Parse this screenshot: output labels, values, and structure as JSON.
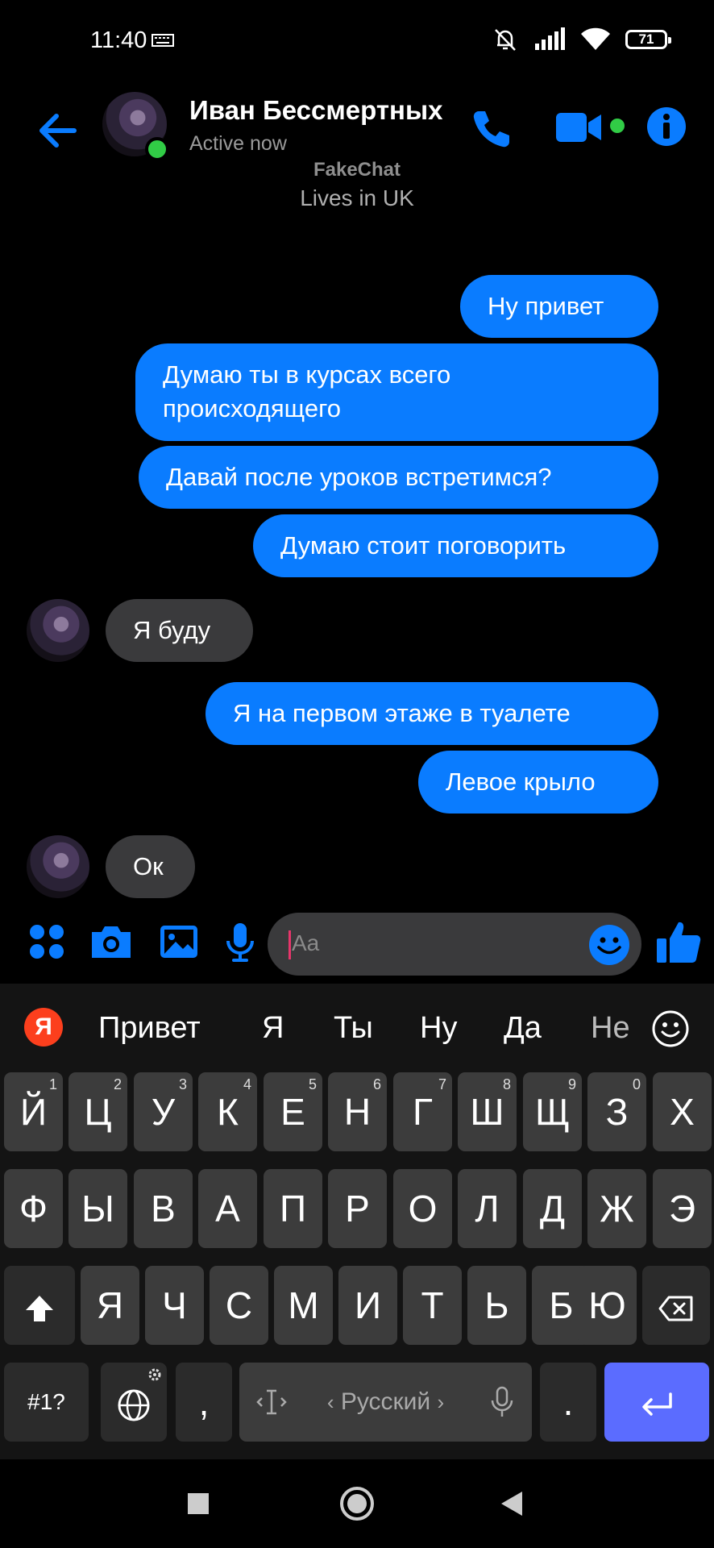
{
  "status": {
    "time": "11:40",
    "battery": "71"
  },
  "header": {
    "name": "Иван Бессмертных",
    "status": "Active now",
    "watermark": "FakeChat",
    "lives": "Lives in UK"
  },
  "messages": [
    {
      "from": "me",
      "text": "Ну привет"
    },
    {
      "from": "me",
      "text": "Думаю ты в курсах всего происходящего"
    },
    {
      "from": "me",
      "text": "Давай после уроков встретимся?"
    },
    {
      "from": "me",
      "text": "Думаю стоит поговорить"
    },
    {
      "from": "them",
      "text": "Я буду"
    },
    {
      "from": "me",
      "text": "Я на первом этаже в туалете"
    },
    {
      "from": "me",
      "text": "Левое крыло"
    },
    {
      "from": "them",
      "text": "Ок"
    }
  ],
  "composer": {
    "placeholder": "Aa"
  },
  "keyboard": {
    "logo": "Я",
    "suggestions": [
      "Привет",
      "Я",
      "Ты",
      "Ну",
      "Да",
      "Не"
    ],
    "row1": [
      {
        "k": "Й",
        "n": "1"
      },
      {
        "k": "Ц",
        "n": "2"
      },
      {
        "k": "У",
        "n": "3"
      },
      {
        "k": "К",
        "n": "4"
      },
      {
        "k": "Е",
        "n": "5"
      },
      {
        "k": "Н",
        "n": "6"
      },
      {
        "k": "Г",
        "n": "7"
      },
      {
        "k": "Ш",
        "n": "8"
      },
      {
        "k": "Щ",
        "n": "9"
      },
      {
        "k": "З",
        "n": "0"
      },
      {
        "k": "Х",
        "n": ""
      }
    ],
    "row2": [
      "Ф",
      "Ы",
      "В",
      "А",
      "П",
      "Р",
      "О",
      "Л",
      "Д",
      "Ж",
      "Э"
    ],
    "row3": [
      "Я",
      "Ч",
      "С",
      "М",
      "И",
      "Т",
      "Ь",
      "Б",
      "Ю"
    ],
    "symbols": "#1?",
    "comma": ",",
    "space_label": "Русский",
    "period": "."
  },
  "colors": {
    "accent": "#0a7cff",
    "incoming": "#3a3a3c",
    "online": "#31cc46",
    "enter": "#5b6cff"
  }
}
